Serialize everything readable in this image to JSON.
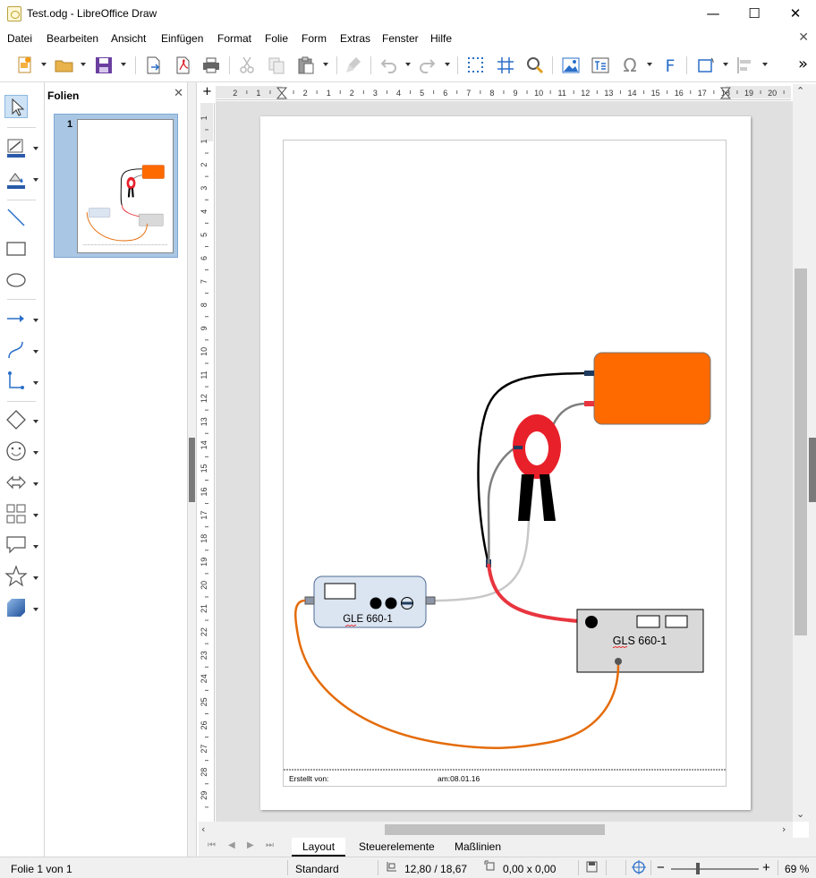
{
  "window": {
    "title": "Test.odg - LibreOffice Draw",
    "controls": {
      "minimize": "—",
      "maximize": "☐",
      "close": "✕"
    }
  },
  "menu": {
    "items": [
      "Datei",
      "Bearbeiten",
      "Ansicht",
      "Einfügen",
      "Format",
      "Folie",
      "Form",
      "Extras",
      "Fenster",
      "Hilfe"
    ],
    "close": "✕"
  },
  "toolbar": {
    "icons": [
      "new-icon",
      "open-icon",
      "save-icon",
      "export-icon",
      "export-pdf-icon",
      "print-icon",
      "cut-icon",
      "copy-icon",
      "paste-icon",
      "clone-formatting-icon",
      "undo-icon",
      "redo-icon",
      "grid-icon",
      "helplines-icon",
      "zoom-icon",
      "image-icon",
      "textbox-icon",
      "special-character-icon",
      "fontwork-icon",
      "transformations-icon",
      "align-icon",
      "more-icon"
    ],
    "more": "»"
  },
  "sidebar_tools": [
    "select-icon",
    "line-color-icon",
    "fill-color-icon",
    "line-icon",
    "rectangle-icon",
    "ellipse-icon",
    "arrow-line-icon",
    "curve-icon",
    "connector-icon",
    "basic-shapes-icon",
    "symbol-shapes-icon",
    "block-arrows-icon",
    "flowchart-icon",
    "callout-icon",
    "stars-icon",
    "3d-objects-icon"
  ],
  "slides_panel": {
    "title": "Folien",
    "close": "✕",
    "slides": [
      {
        "number": "1"
      }
    ]
  },
  "rulers": {
    "corner": "+",
    "h_labels": [
      "2",
      "1",
      "1",
      "2",
      "1",
      "2",
      "3",
      "4",
      "5",
      "6",
      "7",
      "8",
      "9",
      "10",
      "11",
      "12",
      "13",
      "14",
      "15",
      "16",
      "17",
      "18",
      "19",
      "20",
      "21"
    ],
    "v_labels": [
      "1",
      "1",
      "2",
      "3",
      "4",
      "5",
      "6",
      "7",
      "8",
      "9",
      "10",
      "11",
      "12",
      "13",
      "14",
      "15",
      "16",
      "17",
      "18",
      "19",
      "20",
      "21",
      "22",
      "23",
      "24",
      "25",
      "26",
      "27",
      "28",
      "29"
    ]
  },
  "drawing": {
    "device_left": {
      "label": "GLE 660-1"
    },
    "device_right": {
      "label": "GLS 660-1"
    },
    "footer": {
      "created_by": "Erstellt von:",
      "date": "am:08.01.16"
    },
    "colors": {
      "orange_box": "#ff6a00",
      "clamp_red": "#e8202a",
      "cable_orange": "#e46c0a",
      "cable_red": "#e8353f",
      "cable_black": "#000000",
      "cable_gray": "#7f7f7f",
      "cable_lightgray": "#c8c8c8",
      "device_left_fill": "#dbe5f1",
      "device_right_fill": "#d9d9d9"
    }
  },
  "tabs": {
    "nav": [
      "⏮",
      "◀",
      "▶",
      "⏭"
    ],
    "items": [
      "Layout",
      "Steuerelemente",
      "Maßlinien"
    ],
    "active": "Layout"
  },
  "status": {
    "slide": "Folie 1 von 1",
    "style": "Standard",
    "position": "12,80 / 18,67",
    "size": "0,00 x 0,00",
    "zoom": "69 %",
    "zoom_minus": "−",
    "zoom_plus": "+"
  }
}
